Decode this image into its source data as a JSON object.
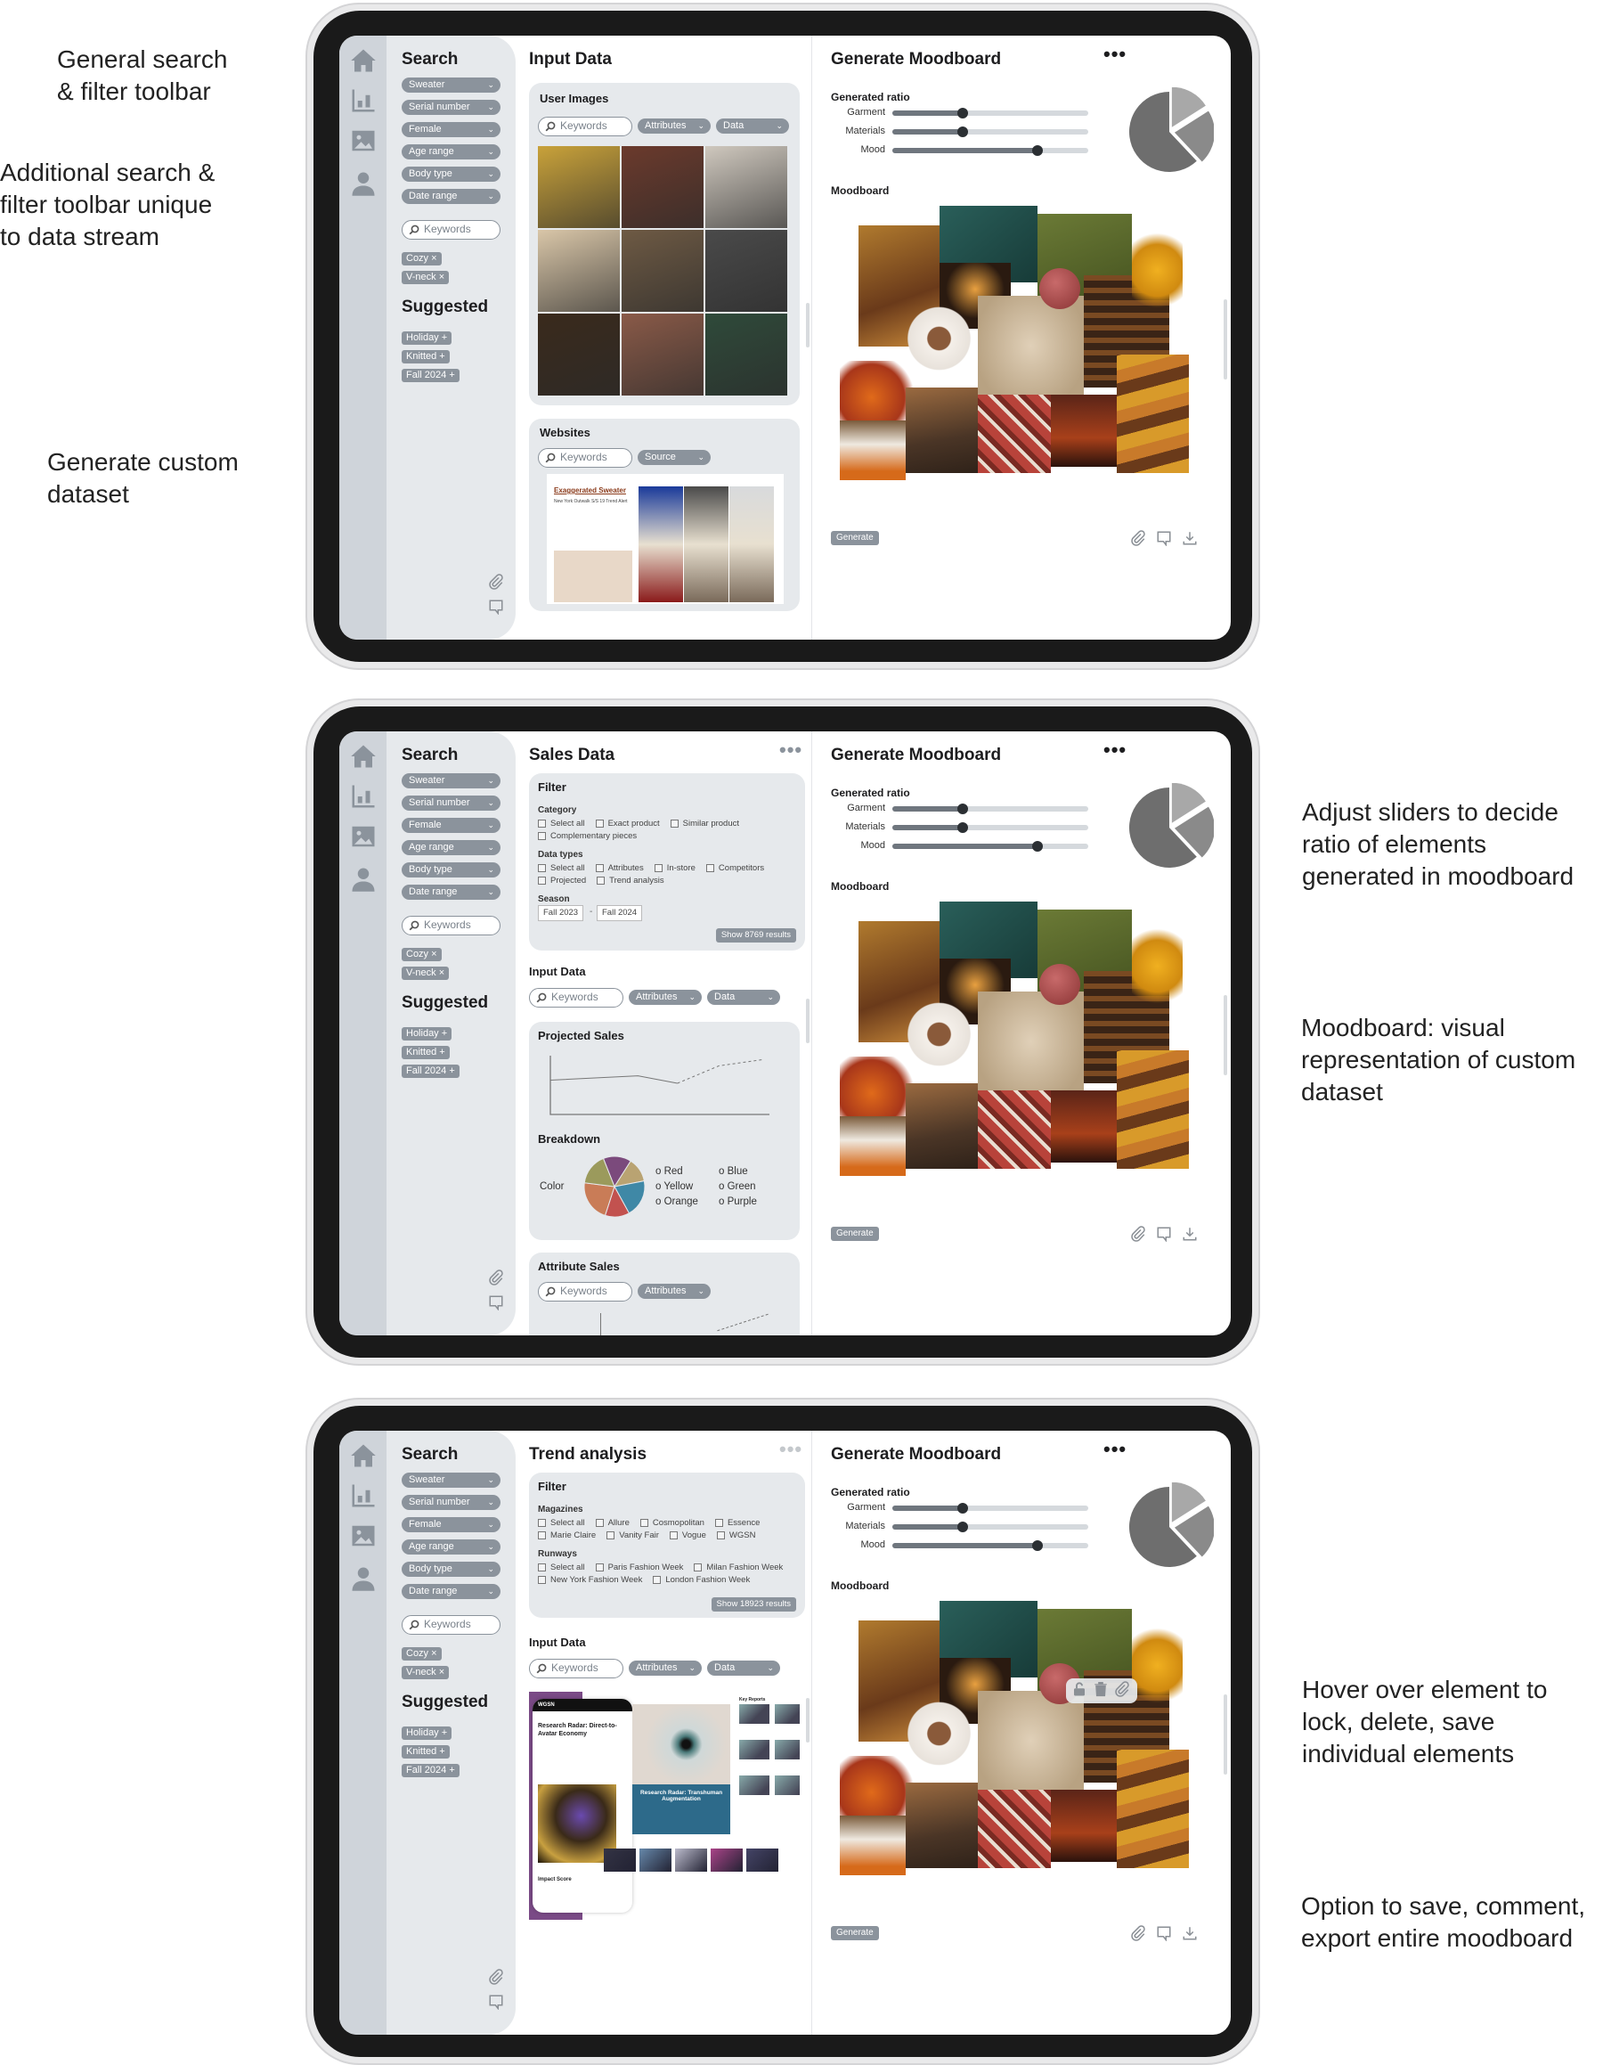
{
  "annotations": [
    {
      "lines": [
        "General search",
        "& filter toolbar"
      ]
    },
    {
      "lines": [
        "Additional search &",
        "filter toolbar unique",
        "to data stream"
      ]
    },
    {
      "lines": [
        "Generate custom",
        "dataset"
      ]
    },
    {
      "lines": [
        "Adjust sliders to decide",
        "ratio of elements",
        "generated in moodboard"
      ]
    },
    {
      "lines": [
        "Moodboard: visual",
        "representation of custom",
        "dataset"
      ]
    },
    {
      "lines": [
        "Hover over element to",
        "lock, delete, save",
        "individual elements"
      ]
    },
    {
      "lines": [
        "Option to save, comment,",
        "export entire moodboard"
      ]
    }
  ],
  "rail": {
    "icons": [
      "home-icon",
      "bar-chart-icon",
      "image-icon",
      "user-icon"
    ]
  },
  "sidebar": {
    "search_title": "Search",
    "filters": [
      "Sweater",
      "Serial number",
      "Female",
      "Age range",
      "Body type",
      "Date range"
    ],
    "keywords_placeholder": "Keywords",
    "tags": [
      "Cozy",
      "V-neck"
    ],
    "suggested_title": "Suggested",
    "suggested": [
      "Holiday",
      "Knitted",
      "Fall 2024"
    ]
  },
  "moodboard": {
    "title": "Generate Moodboard",
    "ratio_label": "Generated ratio",
    "sliders": [
      {
        "label": "Garment",
        "value": 0.36
      },
      {
        "label": "Materials",
        "value": 0.36
      },
      {
        "label": "Mood",
        "value": 0.74
      }
    ],
    "pie": [
      {
        "value": 0.16,
        "color": "#a8a8a8"
      },
      {
        "value": 0.22,
        "color": "#8a8a8a"
      },
      {
        "value": 0.62,
        "color": "#6e6e6e"
      }
    ],
    "moodboard_label": "Moodboard",
    "generate_label": "Generate",
    "actions": [
      "paperclip-icon",
      "comment-icon",
      "download-icon"
    ],
    "hover_actions": [
      "lock-icon",
      "trash-icon",
      "paperclip-icon"
    ]
  },
  "screen1": {
    "title": "Input Data",
    "user_images": {
      "title": "User Images",
      "keywords": "Keywords",
      "attributes": "Attributes",
      "data": "Data",
      "photos": [
        "#c9a23a",
        "#6b3a2c",
        "#cfc8be",
        "#d9c6a8",
        "#6e5a44",
        "#4a4a4a",
        "#3a2a1c",
        "#8a5a48",
        "#2f4a3a"
      ]
    },
    "websites": {
      "title": "Websites",
      "keywords": "Keywords",
      "source": "Source",
      "article_title": "Exaggerated Sweater",
      "article_subtitle": "New York Outwalk S/S 19 Trend Alert"
    }
  },
  "screen2": {
    "title": "Sales Data",
    "filter": {
      "title": "Filter",
      "groups": [
        {
          "label": "Category",
          "rows": [
            [
              "Select all",
              "Exact product",
              "Similar product"
            ],
            [
              "Complementary pieces"
            ]
          ]
        },
        {
          "label": "Data types",
          "rows": [
            [
              "Select all",
              "Attributes",
              "In-store",
              "Competitors"
            ],
            [
              "Projected",
              "Trend analysis"
            ]
          ]
        }
      ],
      "season_label": "Season",
      "season_from": "Fall 2023",
      "season_to": "Fall 2024",
      "show_results": "Show 8769 results"
    },
    "input_data": {
      "title": "Input Data",
      "keywords": "Keywords",
      "attributes": "Attributes",
      "data": "Data"
    },
    "projected_sales": {
      "title": "Projected Sales",
      "actual": [
        [
          0,
          0.55
        ],
        [
          0.4,
          0.62
        ],
        [
          0.58,
          0.5
        ]
      ],
      "projected": [
        [
          0.58,
          0.5
        ],
        [
          0.77,
          0.78
        ],
        [
          0.97,
          0.88
        ]
      ]
    },
    "breakdown": {
      "title": "Breakdown",
      "label": "Color",
      "legend": [
        "Red",
        "Yellow",
        "Orange",
        "Blue",
        "Green",
        "Purple"
      ],
      "slices": [
        {
          "value": 0.15,
          "color": "#7b4a7c"
        },
        {
          "value": 0.13,
          "color": "#b9a372"
        },
        {
          "value": 0.2,
          "color": "#3f88a6"
        },
        {
          "value": 0.13,
          "color": "#c2524f"
        },
        {
          "value": 0.22,
          "color": "#c97c57"
        },
        {
          "value": 0.17,
          "color": "#9b9a5c"
        }
      ]
    },
    "attribute_sales": {
      "title": "Attribute Sales",
      "keywords": "Keywords",
      "attributes": "Attributes"
    }
  },
  "screen3": {
    "title": "Trend analysis",
    "filter": {
      "title": "Filter",
      "groups": [
        {
          "label": "Magazines",
          "rows": [
            [
              "Select all",
              "Allure",
              "Cosmopolitan",
              "Essence"
            ],
            [
              "Marie Claire",
              "Vanity Fair",
              "Vogue",
              "WGSN"
            ]
          ]
        },
        {
          "label": "Runways",
          "rows": [
            [
              "Select all",
              "Paris Fashion Week",
              "Milan Fashion Week"
            ],
            [
              "New York Fashion Week",
              "London Fashion Week"
            ]
          ]
        }
      ],
      "show_results": "Show 18923 results"
    },
    "input_data": {
      "title": "Input Data",
      "keywords": "Keywords",
      "attributes": "Attributes",
      "data": "Data"
    },
    "wgsn": {
      "brand": "WGSN",
      "article": "Research Radar: Direct-to-Avatar Economy",
      "feature": "Research Radar: Transhuman Augmentation",
      "key_reports": "Key Reports",
      "impact": "Impact Score"
    }
  }
}
